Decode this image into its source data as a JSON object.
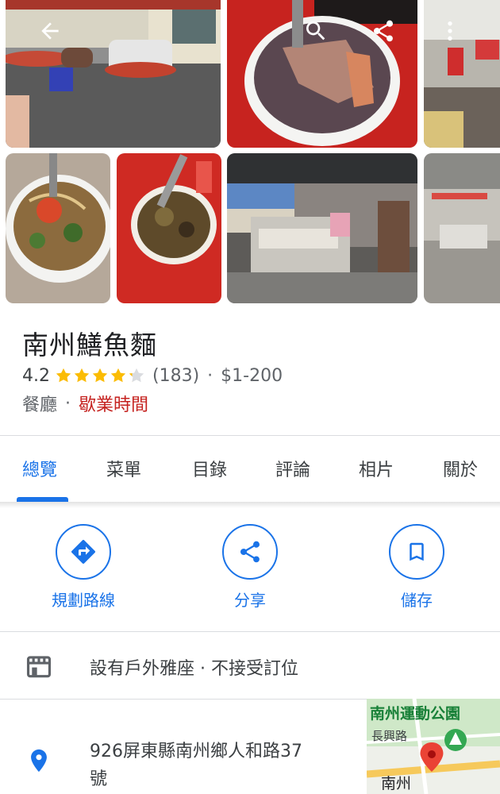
{
  "header": {
    "back_icon": "arrow-back-icon",
    "search_icon": "search-icon",
    "share_icon": "share-icon",
    "more_icon": "more-vertical-icon"
  },
  "place": {
    "name": "南州鱔魚麵",
    "rating": "4.2",
    "rating_value": 4.2,
    "stars_max": 5,
    "review_count": "(183)",
    "separator": "·",
    "price": "$1-200",
    "category": "餐廳",
    "hours_label": "歇業時間"
  },
  "tabs": [
    {
      "label": "總覽",
      "active": true
    },
    {
      "label": "菜單",
      "active": false
    },
    {
      "label": "目錄",
      "active": false
    },
    {
      "label": "評論",
      "active": false
    },
    {
      "label": "相片",
      "active": false
    },
    {
      "label": "關於",
      "active": false
    }
  ],
  "actions": [
    {
      "label": "規劃路線",
      "icon": "directions-icon"
    },
    {
      "label": "分享",
      "icon": "share-icon"
    },
    {
      "label": "儲存",
      "icon": "bookmark-icon"
    }
  ],
  "info": {
    "amenities": "設有戶外雅座 · 不接受訂位",
    "amenities_icon": "storefront-icon",
    "address_line1": "926屏東縣南州鄉人和路37",
    "address_line2": "號",
    "address_icon": "location-pin-icon"
  },
  "map": {
    "park_label": "南州運動公園",
    "road_label": "長興路",
    "town_label": "南州"
  },
  "colors": {
    "accent": "#1a73e8",
    "star": "#fbbc04",
    "closed": "#c5221f",
    "pin": "#ea4335"
  }
}
